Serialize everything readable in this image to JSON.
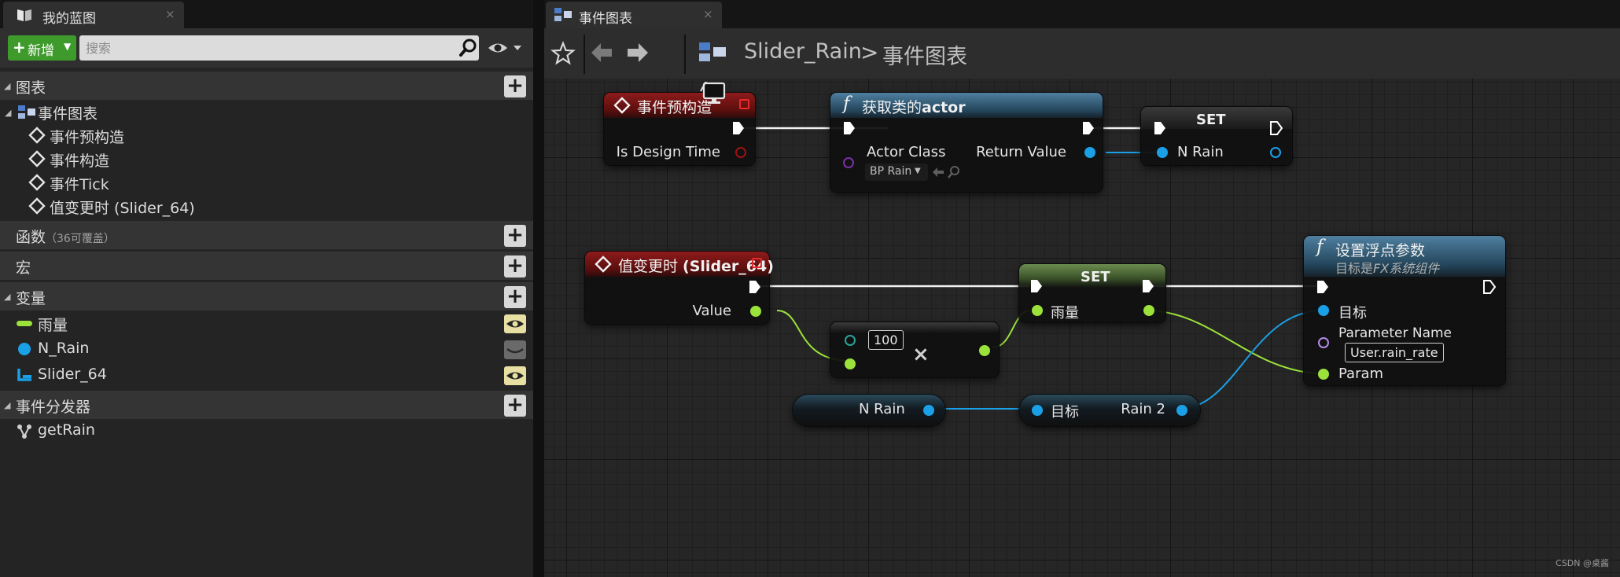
{
  "left_panel": {
    "tab_title": "我的蓝图",
    "tab_close": "×",
    "add_button": "新增",
    "search_placeholder": "搜索",
    "sections": {
      "graphs": "图表",
      "functions": "函数",
      "functions_sub": "（36可覆盖）",
      "macros": "宏",
      "variables": "变量",
      "dispatchers": "事件分发器"
    },
    "event_graph": "事件图表",
    "events": [
      "事件预构造",
      "事件构造",
      "事件Tick",
      "值变更时 (Slider_64)"
    ],
    "variables": [
      "雨量",
      "N_Rain",
      "Slider_64"
    ],
    "dispatchers": [
      "getRain"
    ]
  },
  "editor": {
    "tab_title": "事件图表",
    "tab_close": "×",
    "breadcrumb": [
      "Slider_Rain",
      "事件图表"
    ],
    "watermark": "CSDN @桌酱"
  },
  "nodes": {
    "pre_construct": {
      "title": "事件预构造",
      "pin": "Is Design Time"
    },
    "get_actor": {
      "title_prefix": "获取类的",
      "title_bold": "actor",
      "in_pin": "Actor Class",
      "class_value": "BP Rain",
      "out_pin": "Return Value"
    },
    "set1": {
      "title": "SET",
      "pin": "N Rain"
    },
    "on_value_changed": {
      "title_prefix": "值变更时 ",
      "title_bold": "(Slider_64)",
      "pin": "Value"
    },
    "multiply": {
      "constant": "100",
      "op": "×"
    },
    "set2": {
      "title": "SET",
      "pin": "雨量"
    },
    "set_float": {
      "title": "设置浮点参数",
      "subtitle_prefix": "目标是",
      "subtitle_em": "FX系统组件",
      "pin_target": "目标",
      "pin_param_name": "Parameter Name",
      "param_name_value": "User.rain_rate",
      "pin_param": "Param"
    },
    "get_nrain": {
      "pin": "N Rain"
    },
    "rain2_getter": {
      "in_pin": "目标",
      "out_pin": "Rain 2"
    }
  },
  "colors": {
    "exec_pin": "#ffffff",
    "object_pin": "#1aa0e6",
    "float_pin": "#9be23a",
    "bool_pin": "#9c1212",
    "class_pin": "#7a2fa8",
    "name_pin": "#b48ce6",
    "event_header": "#8e1b1b",
    "function_header": "#4f7fa0",
    "set_header": "#6c8c50",
    "add_button": "#3f9a2c"
  }
}
